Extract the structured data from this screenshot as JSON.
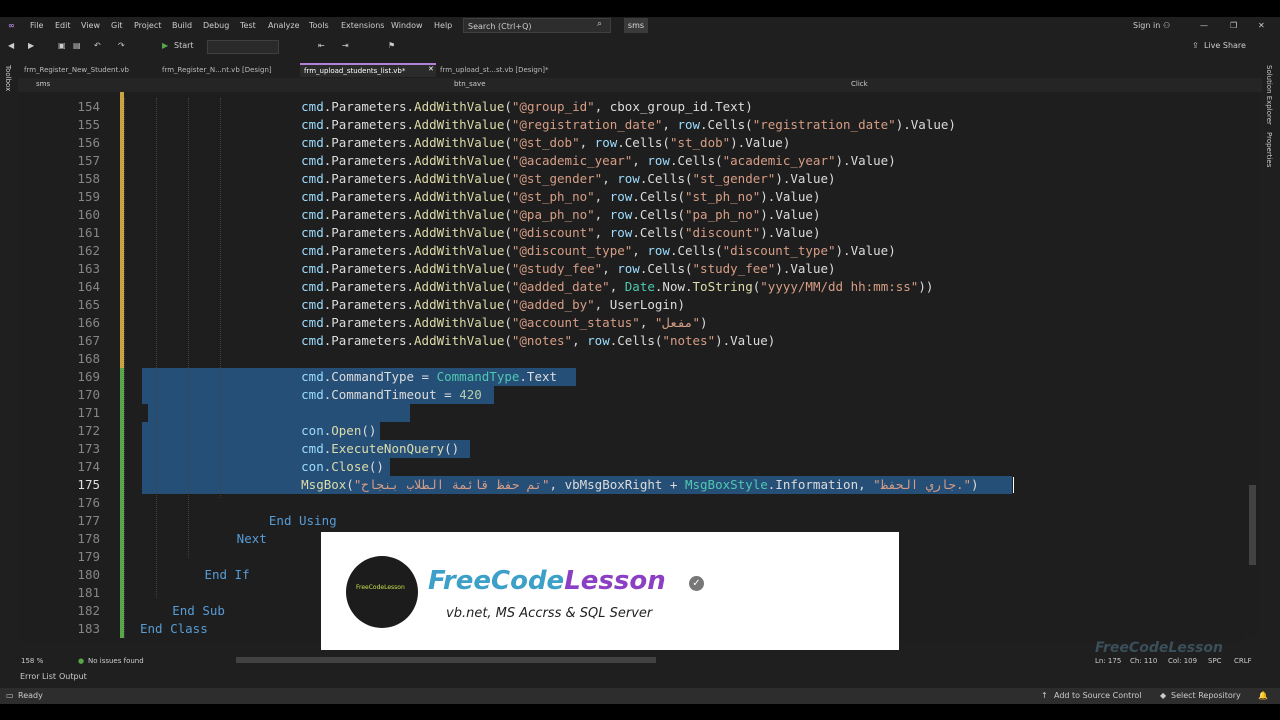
{
  "title_bar": {
    "menu": [
      "File",
      "Edit",
      "View",
      "Git",
      "Project",
      "Build",
      "Debug",
      "Test",
      "Analyze",
      "Tools",
      "Extensions",
      "Window",
      "Help"
    ],
    "search_placeholder": "Search (Ctrl+Q)",
    "solution_name": "sms",
    "sign_in": "Sign in",
    "live_share": "Live Share"
  },
  "toolbar": {
    "start_label": "Start"
  },
  "side_panels": {
    "left": "Toolbox",
    "right_1": "Solution Explorer",
    "right_2": "Properties"
  },
  "tabs": [
    {
      "label": "frm_Register_New_Student.vb"
    },
    {
      "label": "frm_Register_N...nt.vb [Design]"
    },
    {
      "label": "frm_upload_students_list.vb*",
      "active": true
    },
    {
      "label": "frm_upload_st...st.vb [Design]*"
    }
  ],
  "navbar": {
    "project": "sms",
    "object": "btn_save",
    "event": "Click"
  },
  "editor": {
    "line_numbers": [
      "154",
      "155",
      "156",
      "157",
      "158",
      "159",
      "160",
      "161",
      "162",
      "163",
      "164",
      "165",
      "166",
      "167",
      "168",
      "169",
      "170",
      "171",
      "172",
      "173",
      "174",
      "175",
      "176",
      "177",
      "178",
      "179",
      "180",
      "181",
      "182",
      "183"
    ],
    "current_line": "175"
  },
  "overlay": {
    "logo_text": "FreeCodeLesson",
    "brand_part1": "FreeCode",
    "brand_part2": "Lesson",
    "tagline": "vb.net,  MS Accrss & SQL Server",
    "watermark": "FreeCodeLesson"
  },
  "editor_status": {
    "zoom": "158 %",
    "issues": "No issues found",
    "ln": "Ln: 175",
    "ch": "Ch: 110",
    "col": "Col: 109",
    "spc": "SPC",
    "crlf": "CRLF"
  },
  "bottom_tabs": [
    "Error List",
    "Output"
  ],
  "status_bar": {
    "ready": "Ready",
    "source_control": "Add to Source Control",
    "repo": "Select Repository"
  }
}
